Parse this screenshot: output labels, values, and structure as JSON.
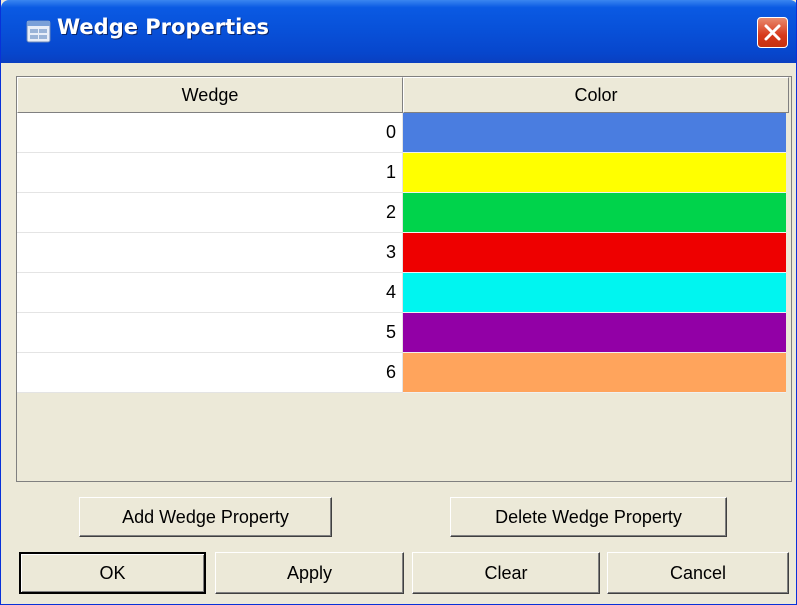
{
  "window": {
    "title": "Wedge Properties"
  },
  "table": {
    "columns": [
      "Wedge",
      "Color"
    ],
    "rows": [
      {
        "wedge": "0",
        "color": "#4a7de0"
      },
      {
        "wedge": "1",
        "color": "#ffff00"
      },
      {
        "wedge": "2",
        "color": "#00d34b"
      },
      {
        "wedge": "3",
        "color": "#ee0000"
      },
      {
        "wedge": "4",
        "color": "#00f5f0"
      },
      {
        "wedge": "5",
        "color": "#9200a6"
      },
      {
        "wedge": "6",
        "color": "#ffa45c"
      }
    ]
  },
  "buttons": {
    "add": "Add Wedge Property",
    "delete": "Delete Wedge Property",
    "ok": "OK",
    "apply": "Apply",
    "clear": "Clear",
    "cancel": "Cancel"
  },
  "colors": {
    "title_bar": "#0a58e0",
    "close_button": "#d7391b",
    "dialog_bg": "#ece9d8"
  }
}
